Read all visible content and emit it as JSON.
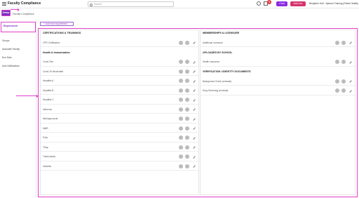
{
  "app": {
    "title": "Faculty Compliance"
  },
  "search": {
    "placeholder": "Search"
  },
  "header": {
    "badge_count": "3",
    "chat_label": "Chat",
    "ask_label": "Ask Leo",
    "user_name": "Benjamin Holt · Nyenne Training (Public Health)"
  },
  "setup": {
    "label": "Setup"
  },
  "breadcrumb": {
    "page_tab": "Faculty Compliance"
  },
  "sidebar": {
    "items": [
      {
        "label": "Requirement"
      },
      {
        "label": "Groups"
      },
      {
        "label": "Associate Faculty"
      },
      {
        "label": "Due Date"
      },
      {
        "label": "Auto Notifications"
      }
    ]
  },
  "main": {
    "add_button_label": "+ Add new requirement",
    "left_sections": [
      {
        "title": "CERTIFICATIONS & TRAININGS",
        "items": [
          "CPR Certification"
        ]
      },
      {
        "title": "Health & Immunization",
        "items": [
          "Covid Test",
          "Covid-19 Vaccinated",
          "Hepatitis A",
          "Hepatitis B",
          "Hepatitis C",
          "Influenza",
          "Meningococcal",
          "MMR",
          "Polio",
          "TDap",
          "Tuberculosis",
          "Varicella"
        ]
      }
    ],
    "right_sections": [
      {
        "title": "MEMBERSHIPS & LICENSURE",
        "items": [
          "Additional Licensure"
        ]
      },
      {
        "title": "UPLOADED BY SCHOOL",
        "items": [
          "Health Insurance"
        ]
      },
      {
        "title": "VERIFICATION / IDENTITY DOCUMENTS",
        "items": [
          "Background Check (renewal)",
          "Drug Screening (renewal)"
        ]
      }
    ]
  }
}
